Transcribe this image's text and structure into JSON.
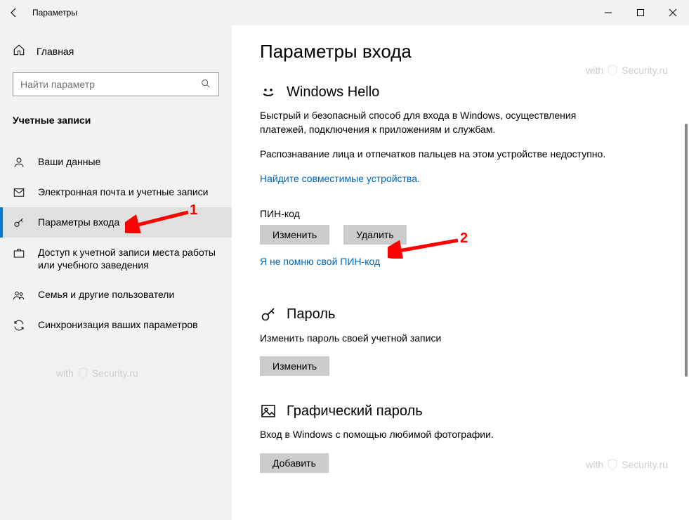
{
  "window": {
    "title": "Параметры"
  },
  "sidebar": {
    "home_label": "Главная",
    "search_placeholder": "Найти параметр",
    "section_title": "Учетные записи",
    "items": [
      {
        "label": "Ваши данные",
        "icon": "person-icon"
      },
      {
        "label": "Электронная почта и учетные записи",
        "icon": "mail-icon"
      },
      {
        "label": "Параметры входа",
        "icon": "key-icon",
        "active": true
      },
      {
        "label": "Доступ к учетной записи места работы или учебного заведения",
        "icon": "briefcase-icon"
      },
      {
        "label": "Семья и другие пользователи",
        "icon": "people-icon"
      },
      {
        "label": "Синхронизация ваших параметров",
        "icon": "sync-icon"
      }
    ]
  },
  "page": {
    "title": "Параметры входа",
    "hello": {
      "heading": "Windows Hello",
      "desc": "Быстрый и безопасный способ для входа в Windows, осуществления платежей, подключения к приложениям и службам.",
      "unavailable": "Распознавание лица и отпечатков пальцев на этом устройстве недоступно.",
      "find_link": "Найдите совместимые устройства.",
      "pin_label": "ПИН-код",
      "pin_change": "Изменить",
      "pin_delete": "Удалить",
      "forgot_link": "Я не помню свой ПИН-код"
    },
    "password": {
      "heading": "Пароль",
      "desc": "Изменить пароль своей учетной записи",
      "change": "Изменить"
    },
    "picture": {
      "heading": "Графический пароль",
      "desc": "Вход в Windows с помощью любимой фотографии.",
      "add": "Добавить"
    }
  },
  "watermark": "withSecurity.ru",
  "annotations": {
    "marker1": "1",
    "marker2": "2"
  }
}
